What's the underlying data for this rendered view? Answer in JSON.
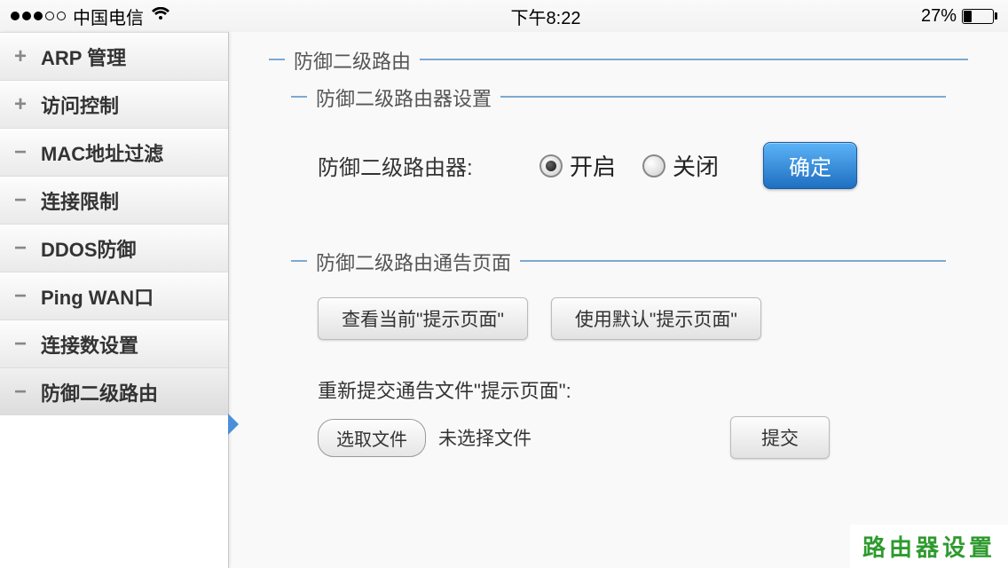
{
  "status_bar": {
    "carrier": "中国电信",
    "time": "下午8:22",
    "battery_pct": "27%"
  },
  "sidebar": {
    "items": [
      {
        "icon": "+",
        "label": "ARP 管理"
      },
      {
        "icon": "+",
        "label": "访问控制"
      },
      {
        "icon": "−",
        "label": "MAC地址过滤"
      },
      {
        "icon": "−",
        "label": "连接限制"
      },
      {
        "icon": "−",
        "label": "DDOS防御"
      },
      {
        "icon": "−",
        "label": "Ping WAN口"
      },
      {
        "icon": "−",
        "label": "连接数设置"
      },
      {
        "icon": "−",
        "label": "防御二级路由"
      }
    ]
  },
  "main": {
    "outer_legend": "防御二级路由",
    "section1": {
      "legend": "防御二级路由器设置",
      "label": "防御二级路由器:",
      "opt_on": "开启",
      "opt_off": "关闭",
      "confirm": "确定"
    },
    "section2": {
      "legend": "防御二级路由通告页面",
      "view_btn": "查看当前\"提示页面\"",
      "default_btn": "使用默认\"提示页面\"",
      "resubmit_label": "重新提交通告文件\"提示页面\":",
      "choose_file": "选取文件",
      "no_file": "未选择文件",
      "submit": "提交"
    }
  },
  "watermark": "路由器设置"
}
